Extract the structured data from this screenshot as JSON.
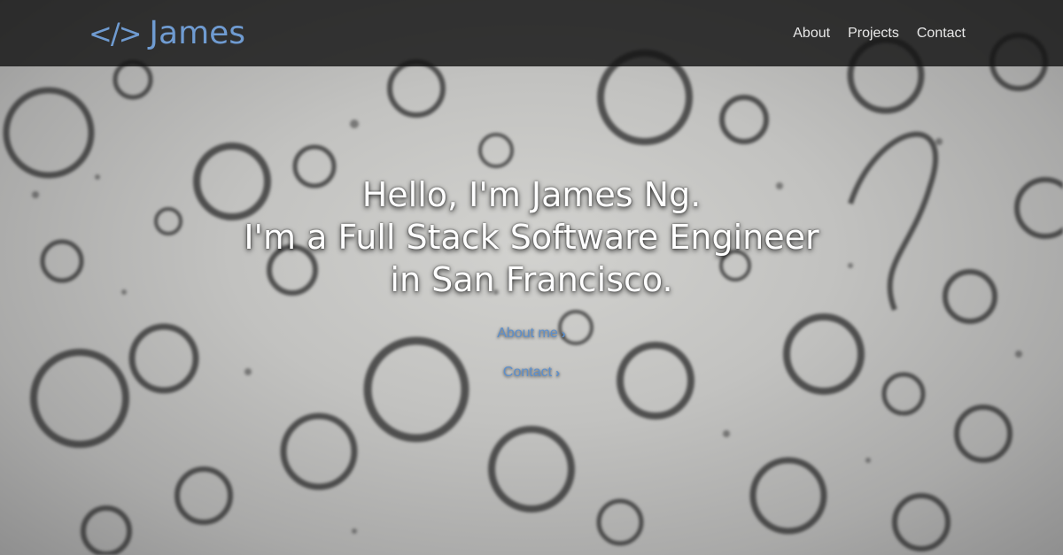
{
  "navbar": {
    "brand_icon": "</>",
    "brand_name": "James",
    "links": [
      {
        "label": "About"
      },
      {
        "label": "Projects"
      },
      {
        "label": "Contact"
      }
    ]
  },
  "hero": {
    "headline_lines": [
      "Hello, I'm James Ng.",
      "I'm a Full Stack Software Engineer",
      "in San Francisco."
    ],
    "cta": [
      {
        "label": "About me",
        "icon": "chevron-right-icon"
      },
      {
        "label": "Contact",
        "icon": "chevron-right-icon"
      }
    ]
  },
  "colors": {
    "accent": "#6f9bd1",
    "navbar_bg": "#141414",
    "headline": "#ffffff"
  }
}
